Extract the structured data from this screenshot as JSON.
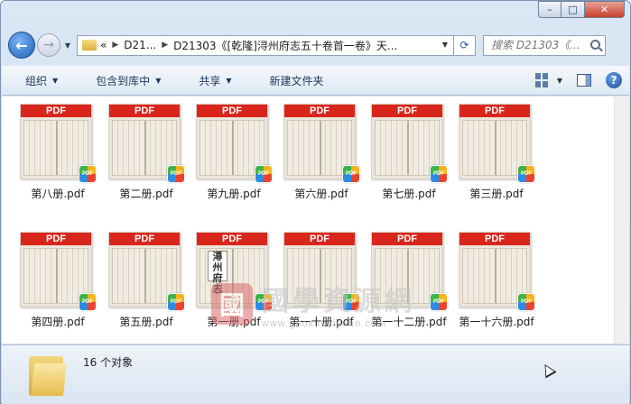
{
  "window": {
    "minimize_label": "–",
    "maximize_label": "□",
    "close_label": "✕"
  },
  "nav": {
    "back_glyph": "←",
    "forward_glyph": "→",
    "history_caret": "▼"
  },
  "address": {
    "overflow": "«",
    "crumbs": [
      "D21...",
      "D21303《[乾隆]浔州府志五十卷首一卷》天..."
    ],
    "refresh_glyph": "⟳"
  },
  "search": {
    "placeholder": "搜索 D21303《..."
  },
  "toolbar": {
    "organize": "组织",
    "include_in_library": "包含到库中",
    "share": "共享",
    "new_folder": "新建文件夹",
    "help": "?"
  },
  "files": [
    {
      "name": "第八册.pdf",
      "cover": ""
    },
    {
      "name": "第二册.pdf",
      "cover": ""
    },
    {
      "name": "第九册.pdf",
      "cover": ""
    },
    {
      "name": "第六册.pdf",
      "cover": ""
    },
    {
      "name": "第七册.pdf",
      "cover": ""
    },
    {
      "name": "第三册.pdf",
      "cover": ""
    },
    {
      "name": "第四册.pdf",
      "cover": ""
    },
    {
      "name": "第五册.pdf",
      "cover": ""
    },
    {
      "name": "第一册.pdf",
      "cover": "潯州府志"
    },
    {
      "name": "第一十册.pdf",
      "cover": ""
    },
    {
      "name": "第一十二册.pdf",
      "cover": ""
    },
    {
      "name": "第一十六册.pdf",
      "cover": ""
    }
  ],
  "thumbnail": {
    "band_label": "PDF",
    "badge_label": "PDF"
  },
  "watermark": {
    "seal": "國",
    "chinese": "國學資源網",
    "url": "www.guoxueziyuan.com"
  },
  "status": {
    "count": "16 个对象"
  }
}
